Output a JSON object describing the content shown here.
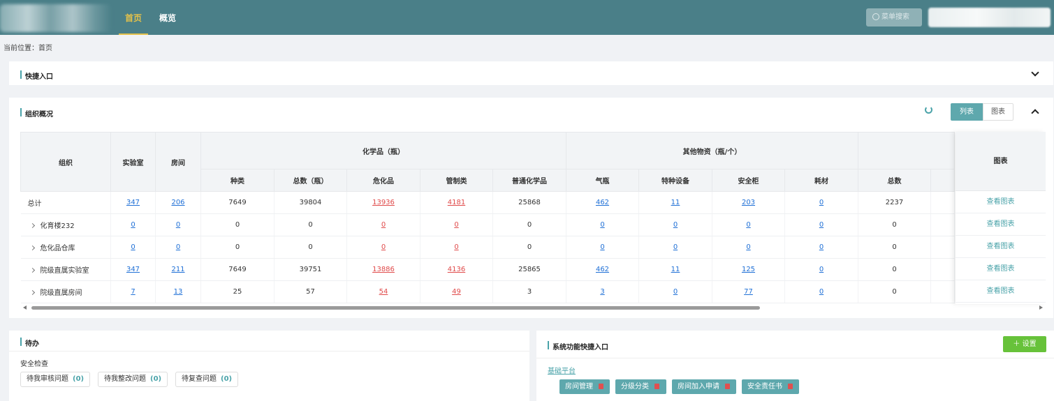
{
  "topbar": {
    "tabs": [
      {
        "label": "首页",
        "active": true
      },
      {
        "label": "概览",
        "active": false
      }
    ],
    "menu_search_placeholder": "菜单搜索"
  },
  "breadcrumb": "当前位置：首页",
  "quick_entry": {
    "title": "快捷入口"
  },
  "org_overview": {
    "title": "组织概况",
    "view_toggle": [
      "列表",
      "图表"
    ],
    "headers": {
      "org": "组织",
      "lab": "实验室",
      "room": "房间",
      "chem_group": "化学品（瓶）",
      "other_group": "其他物资（瓶/个）",
      "chem_cols": [
        "种类",
        "总数（瓶）",
        "危化品",
        "管制类",
        "普通化学品"
      ],
      "other_cols": [
        "气瓶",
        "特种设备",
        "安全柜",
        "耗材"
      ],
      "extra_cols": [
        "总数"
      ],
      "chart": "图表"
    },
    "rows": [
      {
        "org": "总计",
        "lab": "347",
        "room": "206",
        "kinds": "7649",
        "total": "39804",
        "hazard": "13936",
        "controlled": "4181",
        "normal": "25868",
        "gas": "462",
        "special": "11",
        "cabinet": "203",
        "consumable": "0",
        "sum": "2237",
        "action": "查看图表"
      },
      {
        "org": "化育楼232",
        "lab": "0",
        "room": "0",
        "kinds": "0",
        "total": "0",
        "hazard": "0",
        "controlled": "0",
        "normal": "0",
        "gas": "0",
        "special": "0",
        "cabinet": "0",
        "consumable": "0",
        "sum": "0",
        "action": "查看图表"
      },
      {
        "org": "危化品仓库",
        "lab": "0",
        "room": "0",
        "kinds": "0",
        "total": "0",
        "hazard": "0",
        "controlled": "0",
        "normal": "0",
        "gas": "0",
        "special": "0",
        "cabinet": "0",
        "consumable": "0",
        "sum": "0",
        "action": "查看图表"
      },
      {
        "org": "院级直属实验室",
        "lab": "347",
        "room": "211",
        "kinds": "7649",
        "total": "39751",
        "hazard": "13886",
        "controlled": "4136",
        "normal": "25865",
        "gas": "462",
        "special": "11",
        "cabinet": "125",
        "consumable": "0",
        "sum": "0",
        "action": "查看图表"
      },
      {
        "org": "院级直属房间",
        "lab": "7",
        "room": "13",
        "kinds": "25",
        "total": "57",
        "hazard": "54",
        "controlled": "49",
        "normal": "3",
        "gas": "3",
        "special": "0",
        "cabinet": "77",
        "consumable": "0",
        "sum": "0",
        "action": "查看图表"
      }
    ]
  },
  "todo": {
    "title": "待办",
    "section": "安全检查",
    "buttons": [
      {
        "label": "待我审核问题",
        "count": "(0)"
      },
      {
        "label": "待我整改问题",
        "count": "(0)"
      },
      {
        "label": "待复查问题",
        "count": "(0)"
      }
    ]
  },
  "sys_entry": {
    "title": "系统功能快捷入口",
    "set_label": "＋ 设置",
    "group": "基础平台",
    "tags": [
      "房间管理",
      "分级分类",
      "房间加入申请",
      "安全责任书"
    ]
  }
}
